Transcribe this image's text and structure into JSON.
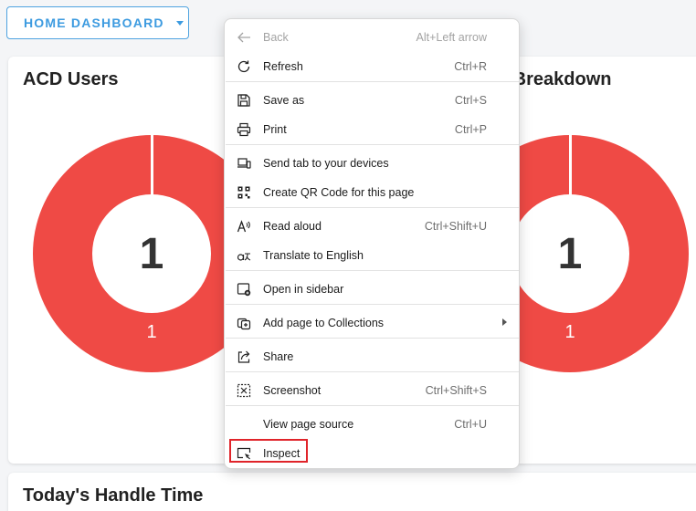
{
  "header": {
    "dashboard_button": "HOME DASHBOARD"
  },
  "cards": {
    "acd_users": {
      "title": "ACD Users",
      "center_value": "1",
      "segment_value": "1"
    },
    "breakdown": {
      "title": "y Breakdown",
      "center_value": "1",
      "segment_value": "1"
    },
    "handle_time": {
      "title": "Today's Handle Time"
    }
  },
  "colors": {
    "accent": "#3d9be0",
    "donut": "#ef4a45",
    "highlight": "#e0242a"
  },
  "context_menu": {
    "items": [
      {
        "label": "Back",
        "shortcut": "Alt+Left arrow",
        "icon": "back-arrow-icon",
        "disabled": true
      },
      {
        "label": "Refresh",
        "shortcut": "Ctrl+R",
        "icon": "refresh-icon"
      },
      {
        "label": "Save as",
        "shortcut": "Ctrl+S",
        "icon": "save-icon"
      },
      {
        "label": "Print",
        "shortcut": "Ctrl+P",
        "icon": "print-icon"
      },
      {
        "label": "Send tab to your devices",
        "shortcut": "",
        "icon": "devices-icon"
      },
      {
        "label": "Create QR Code for this page",
        "shortcut": "",
        "icon": "qr-code-icon"
      },
      {
        "label": "Read aloud",
        "shortcut": "Ctrl+Shift+U",
        "icon": "read-aloud-icon"
      },
      {
        "label": "Translate to English",
        "shortcut": "",
        "icon": "translate-icon"
      },
      {
        "label": "Open in sidebar",
        "shortcut": "",
        "icon": "sidebar-icon"
      },
      {
        "label": "Add page to Collections",
        "shortcut": "",
        "icon": "collections-icon",
        "submenu": true
      },
      {
        "label": "Share",
        "shortcut": "",
        "icon": "share-icon"
      },
      {
        "label": "Screenshot",
        "shortcut": "Ctrl+Shift+S",
        "icon": "screenshot-icon"
      },
      {
        "label": "View page source",
        "shortcut": "Ctrl+U",
        "icon": ""
      },
      {
        "label": "Inspect",
        "shortcut": "",
        "icon": "inspect-icon",
        "highlighted": true
      }
    ]
  }
}
